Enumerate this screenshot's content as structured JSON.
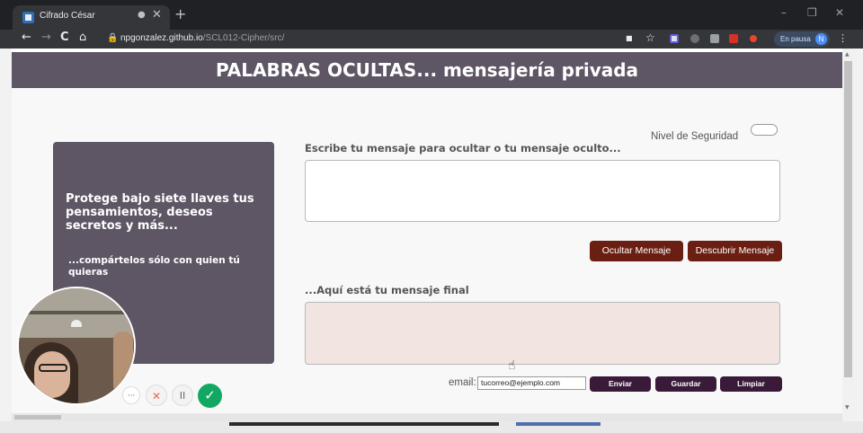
{
  "browser": {
    "tab_title": "Cifrado César",
    "tab_rec_icon": "●",
    "tab_close": "✕",
    "new_tab": "+",
    "window_controls": {
      "minimize": "–",
      "restore": "❐",
      "close": "✕"
    },
    "nav": {
      "back": "←",
      "forward": "→",
      "reload": "C",
      "home": "⌂"
    },
    "url_host": "npgonzalez.github.io",
    "url_path": "/SCL012-Cipher/src/",
    "lock_icon": "🔒",
    "star_icon": "☆",
    "pause_label": "En pausa",
    "avatar_letter": "N",
    "menu_icon": "⋮"
  },
  "page": {
    "title": "PALABRAS OCULTAS... mensajería privada",
    "security_label": "Nivel de Seguridad",
    "sidebar": {
      "headline": "Protege bajo siete llaves tus pensamientos, deseos secretos y más...",
      "subline": "...compártelos sólo con quien tú quieras"
    },
    "input_label": "Escribe tu mensaje para ocultar o tu mensaje oculto...",
    "input_value": "",
    "buttons": {
      "hide": "Ocultar Mensaje",
      "reveal": "Descubrir Mensaje"
    },
    "output_label": "...Aquí está tu mensaje final",
    "output_value": "",
    "email_label": "email:",
    "email_value": "tucorreo@ejemplo.com",
    "actions": {
      "send": "Enviar",
      "save": "Guardar",
      "clear": "Limpiar"
    }
  },
  "recorder": {
    "more": "···",
    "cancel": "✕",
    "pause": "II",
    "confirm": "✓"
  },
  "colors": {
    "banner": "#5e5565",
    "primary_button": "#6b1f12",
    "secondary_button": "#3a1a39",
    "output_bg": "#f1e4e1",
    "confirm_green": "#12a863"
  }
}
